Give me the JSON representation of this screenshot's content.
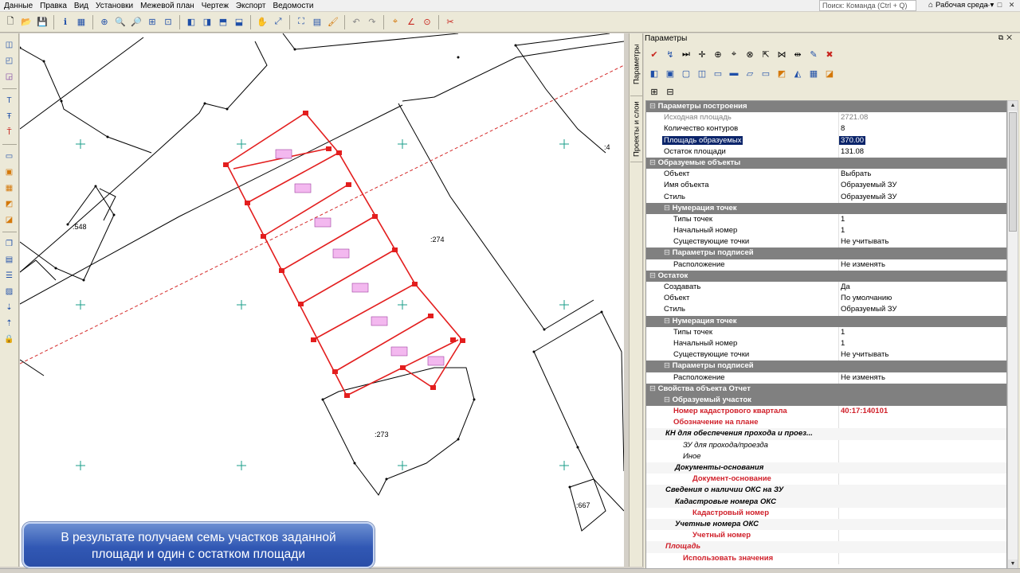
{
  "menu": [
    "Данные",
    "Правка",
    "Вид",
    "Установки",
    "Межевой план",
    "Чертеж",
    "Экспорт",
    "Ведомости"
  ],
  "search": {
    "placeholder": "Поиск: Команда (Ctrl + Q)"
  },
  "workspace": {
    "label": "Рабочая среда"
  },
  "panel": {
    "title": "Параметры"
  },
  "vtabs": {
    "params": "Параметры",
    "projects": "Проекты и слои"
  },
  "map": {
    "labels": [
      ":548",
      ":274",
      ":273",
      ":667",
      ":4"
    ],
    "accent": "#e31e1e"
  },
  "caption": {
    "line1": "В результате получаем семь участков заданной",
    "line2": "площади и один с остатком площади"
  },
  "rows": [
    {
      "type": "hdr",
      "indent": 0,
      "label": "Параметры построения"
    },
    {
      "type": "gray",
      "indent": 1,
      "label": "Исходная площадь",
      "value": "2721.08"
    },
    {
      "type": "",
      "indent": 1,
      "label": "Количество контуров",
      "value": "8"
    },
    {
      "type": "selected",
      "indent": 1,
      "label": "Площадь образуемых",
      "value": "370.00"
    },
    {
      "type": "",
      "indent": 1,
      "label": "Остаток площади",
      "value": "131.08"
    },
    {
      "type": "hdr",
      "indent": 0,
      "label": "Образуемые объекты"
    },
    {
      "type": "",
      "indent": 1,
      "label": "Объект",
      "value": "Выбрать"
    },
    {
      "type": "",
      "indent": 1,
      "label": "Имя объекта",
      "value": "Образуемый ЗУ"
    },
    {
      "type": "",
      "indent": 1,
      "label": "Стиль",
      "value": "Образуемый ЗУ"
    },
    {
      "type": "hdr",
      "indent": 1,
      "label": "Нумерация точек"
    },
    {
      "type": "",
      "indent": 2,
      "label": "Типы точек",
      "value": "1"
    },
    {
      "type": "",
      "indent": 2,
      "label": "Начальный номер",
      "value": "1"
    },
    {
      "type": "",
      "indent": 2,
      "label": "Существующие точки",
      "value": "Не учитывать"
    },
    {
      "type": "hdr",
      "indent": 1,
      "label": "Параметры подписей"
    },
    {
      "type": "",
      "indent": 2,
      "label": "Расположение",
      "value": "Не изменять"
    },
    {
      "type": "hdr",
      "indent": 0,
      "label": "Остаток"
    },
    {
      "type": "",
      "indent": 1,
      "label": "Создавать",
      "value": "Да"
    },
    {
      "type": "",
      "indent": 1,
      "label": "Объект",
      "value": "По умолчанию"
    },
    {
      "type": "",
      "indent": 1,
      "label": "Стиль",
      "value": "Образуемый ЗУ"
    },
    {
      "type": "hdr",
      "indent": 1,
      "label": "Нумерация точек"
    },
    {
      "type": "",
      "indent": 2,
      "label": "Типы точек",
      "value": "1"
    },
    {
      "type": "",
      "indent": 2,
      "label": "Начальный номер",
      "value": "1"
    },
    {
      "type": "",
      "indent": 2,
      "label": "Существующие точки",
      "value": "Не учитывать"
    },
    {
      "type": "hdr",
      "indent": 1,
      "label": "Параметры подписей"
    },
    {
      "type": "",
      "indent": 2,
      "label": "Расположение",
      "value": "Не изменять"
    },
    {
      "type": "hdr",
      "indent": 0,
      "label": "Свойства объекта Отчет"
    },
    {
      "type": "hdr",
      "indent": 1,
      "label": "Образуемый участок"
    },
    {
      "type": "red",
      "indent": 2,
      "label": "Номер кадастрового квартала",
      "value": "40:17:140101"
    },
    {
      "type": "red",
      "indent": 2,
      "label": "Обозначение на плане",
      "value": ""
    },
    {
      "type": "hdrit",
      "indent": 2,
      "label": "КН для обеспечения прохода и проез..."
    },
    {
      "type": "it",
      "indent": 3,
      "label": "ЗУ для прохода/проезда",
      "value": ""
    },
    {
      "type": "it",
      "indent": 3,
      "label": "Иное",
      "value": ""
    },
    {
      "type": "hdrit",
      "indent": 3,
      "label": "Документы-основания"
    },
    {
      "type": "red",
      "indent": 4,
      "label": "Документ-основание",
      "value": ""
    },
    {
      "type": "hdrit",
      "indent": 2,
      "label": "Сведения о наличии ОКС на ЗУ"
    },
    {
      "type": "hdrit",
      "indent": 3,
      "label": "Кадастровые номера ОКС"
    },
    {
      "type": "red",
      "indent": 4,
      "label": "Кадастровый номер",
      "value": ""
    },
    {
      "type": "hdrit",
      "indent": 3,
      "label": "Учетные номера ОКС"
    },
    {
      "type": "red",
      "indent": 4,
      "label": "Учетный номер",
      "value": ""
    },
    {
      "type": "hdrred",
      "indent": 2,
      "label": "Площадь"
    },
    {
      "type": "red",
      "indent": 3,
      "label": "Использовать значения",
      "value": ""
    }
  ]
}
